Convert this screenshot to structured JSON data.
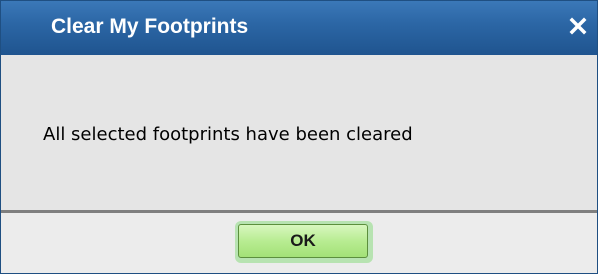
{
  "dialog": {
    "title": "Clear My Footprints",
    "close_icon": "close-icon",
    "message": "All selected footprints have been cleared",
    "ok_label": "OK"
  },
  "colors": {
    "titlebar": "#2c67a6",
    "title_text": "#ffffff",
    "body_background": "#e5e5e5",
    "ok_button": "#b8ec92"
  }
}
